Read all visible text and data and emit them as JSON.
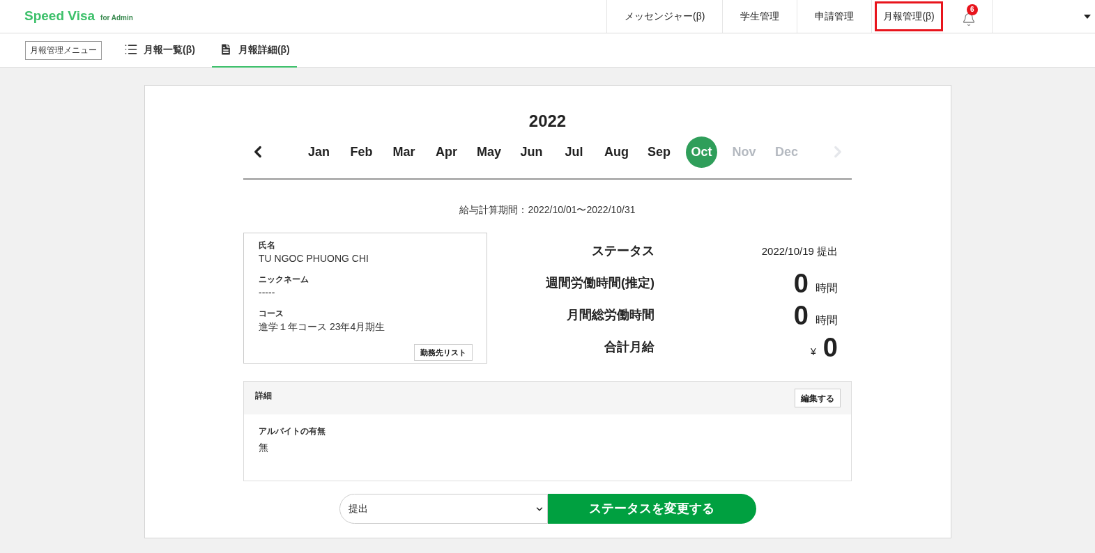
{
  "header": {
    "logo": "Speed Visa",
    "logo_suffix": "for Admin",
    "nav": [
      {
        "label": "メッセンジャー(β)",
        "selected": false
      },
      {
        "label": "学生管理",
        "selected": false
      },
      {
        "label": "申請管理",
        "selected": false
      },
      {
        "label": "月報管理(β)",
        "selected": true
      }
    ],
    "notification_count": "6"
  },
  "subnav": {
    "menu_button": "月報管理メニュー",
    "tabs": [
      {
        "label": "月報一覧(β)",
        "kind": "list",
        "selected": false
      },
      {
        "label": "月報詳細(β)",
        "kind": "document",
        "selected": true
      }
    ]
  },
  "calendar": {
    "year": "2022",
    "prev_disabled": false,
    "next_disabled": true,
    "months": [
      {
        "label": "Jan",
        "selected": false,
        "disabled": false
      },
      {
        "label": "Feb",
        "selected": false,
        "disabled": false
      },
      {
        "label": "Mar",
        "selected": false,
        "disabled": false
      },
      {
        "label": "Apr",
        "selected": false,
        "disabled": false
      },
      {
        "label": "May",
        "selected": false,
        "disabled": false
      },
      {
        "label": "Jun",
        "selected": false,
        "disabled": false
      },
      {
        "label": "Jul",
        "selected": false,
        "disabled": false
      },
      {
        "label": "Aug",
        "selected": false,
        "disabled": false
      },
      {
        "label": "Sep",
        "selected": false,
        "disabled": false
      },
      {
        "label": "Oct",
        "selected": true,
        "disabled": false
      },
      {
        "label": "Nov",
        "selected": false,
        "disabled": true
      },
      {
        "label": "Dec",
        "selected": false,
        "disabled": true
      }
    ]
  },
  "period": "給与計算期間：2022/10/01〜2022/10/31",
  "profile": {
    "fields": [
      {
        "label": "氏名",
        "value": "TU NGOC PHUONG CHI"
      },
      {
        "label": "ニックネーム",
        "value": "-----"
      },
      {
        "label": "コース",
        "value": "進学１年コース 23年4月期生"
      }
    ],
    "button": "勤務先リスト"
  },
  "stats": [
    {
      "kind": "text",
      "label": "ステータス",
      "value": "2022/10/19 提出"
    },
    {
      "kind": "number",
      "label": "週間労働時間(推定)",
      "value": "0",
      "unit": "時間"
    },
    {
      "kind": "number",
      "label": "月間総労働時間",
      "value": "0",
      "unit": "時間"
    },
    {
      "kind": "money",
      "label": "合計月給",
      "value": "0",
      "unit": "¥"
    }
  ],
  "details": {
    "title": "詳細",
    "edit_button": "編集する",
    "fields": [
      {
        "label": "アルバイトの有無",
        "value": "無"
      }
    ]
  },
  "status_select": {
    "value": "提出"
  },
  "submit_button": "ステータスを変更する"
}
